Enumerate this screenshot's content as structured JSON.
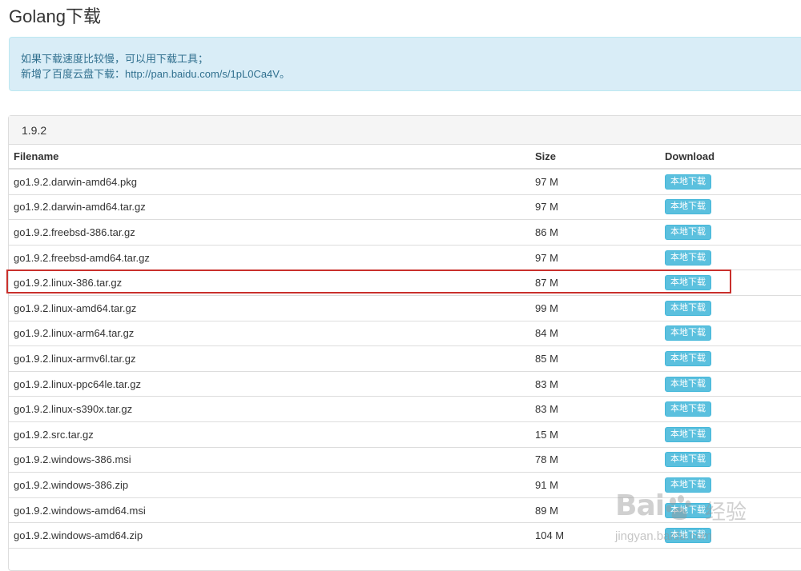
{
  "page": {
    "title": "Golang下载"
  },
  "alert": {
    "line1": "如果下载速度比较慢，可以用下载工具；",
    "line2": "新增了百度云盘下载：http://pan.baidu.com/s/1pL0Ca4V。"
  },
  "panel": {
    "version": "1.9.2"
  },
  "table": {
    "headers": {
      "filename": "Filename",
      "size": "Size",
      "download": "Download"
    },
    "download_label": "本地下载",
    "rows": [
      {
        "filename": "go1.9.2.darwin-amd64.pkg",
        "size": "97 M"
      },
      {
        "filename": "go1.9.2.darwin-amd64.tar.gz",
        "size": "97 M"
      },
      {
        "filename": "go1.9.2.freebsd-386.tar.gz",
        "size": "86 M"
      },
      {
        "filename": "go1.9.2.freebsd-amd64.tar.gz",
        "size": "97 M"
      },
      {
        "filename": "go1.9.2.linux-386.tar.gz",
        "size": "87 M"
      },
      {
        "filename": "go1.9.2.linux-amd64.tar.gz",
        "size": "99 M"
      },
      {
        "filename": "go1.9.2.linux-arm64.tar.gz",
        "size": "84 M"
      },
      {
        "filename": "go1.9.2.linux-armv6l.tar.gz",
        "size": "85 M"
      },
      {
        "filename": "go1.9.2.linux-ppc64le.tar.gz",
        "size": "83 M"
      },
      {
        "filename": "go1.9.2.linux-s390x.tar.gz",
        "size": "83 M"
      },
      {
        "filename": "go1.9.2.src.tar.gz",
        "size": "15 M"
      },
      {
        "filename": "go1.9.2.windows-386.msi",
        "size": "78 M"
      },
      {
        "filename": "go1.9.2.windows-386.zip",
        "size": "91 M"
      },
      {
        "filename": "go1.9.2.windows-amd64.msi",
        "size": "89 M"
      },
      {
        "filename": "go1.9.2.windows-amd64.zip",
        "size": "104 M"
      }
    ]
  },
  "watermark": {
    "logo": "Bai",
    "logo_suffix": "经验",
    "url": "jingyan.baidu.com"
  },
  "colors": {
    "alert_bg": "#d9edf7",
    "alert_text": "#31708f",
    "button_bg": "#5bc0de",
    "highlight_border": "#c9302c"
  }
}
